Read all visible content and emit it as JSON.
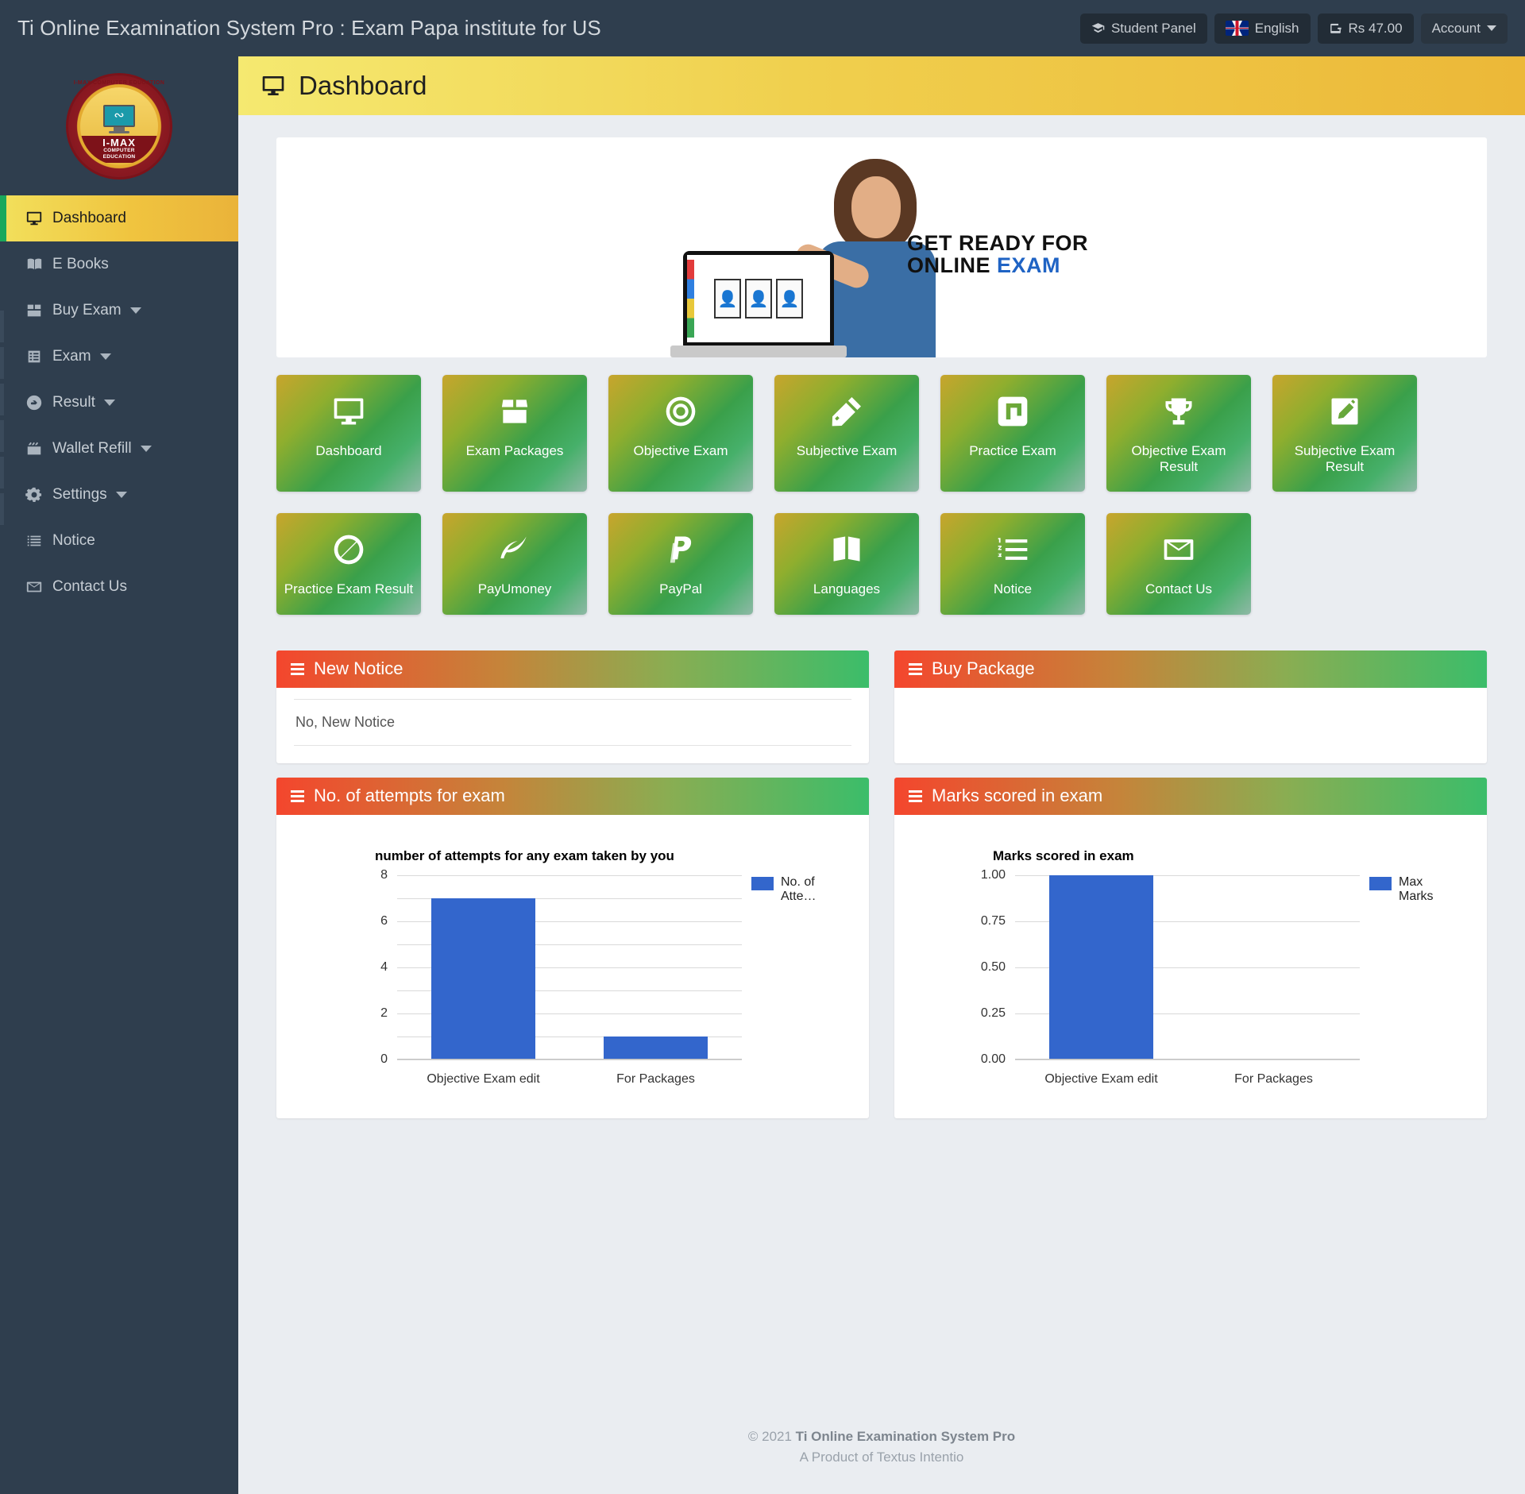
{
  "topbar": {
    "title": "Ti Online Examination System Pro : Exam Papa institute for US",
    "student_panel": "Student Panel",
    "language": "English",
    "wallet": "Rs 47.00",
    "account": "Account"
  },
  "logo": {
    "arc_text": "I-MAX COMPUTER EDUCATION",
    "name": "I-MAX",
    "sub_line1": "COMPUTER",
    "sub_line2": "EDUCATION",
    "ribbon": "I-MAX"
  },
  "sidebar": {
    "items": [
      {
        "label": "Dashboard",
        "icon": "monitor-icon",
        "active": true,
        "has_arrow": false
      },
      {
        "label": "E Books",
        "icon": "book-icon",
        "active": false,
        "has_arrow": false
      },
      {
        "label": "Buy Exam",
        "icon": "box-icon",
        "active": false,
        "has_arrow": true
      },
      {
        "label": "Exam",
        "icon": "list-alt-icon",
        "active": false,
        "has_arrow": true
      },
      {
        "label": "Result",
        "icon": "result-icon",
        "active": false,
        "has_arrow": true
      },
      {
        "label": "Wallet Refill",
        "icon": "wallet-icon",
        "active": false,
        "has_arrow": true
      },
      {
        "label": "Settings",
        "icon": "gears-icon",
        "active": false,
        "has_arrow": true
      },
      {
        "label": "Notice",
        "icon": "notice-icon",
        "active": false,
        "has_arrow": false
      },
      {
        "label": "Contact Us",
        "icon": "envelope-icon",
        "active": false,
        "has_arrow": false
      }
    ]
  },
  "page": {
    "title": "Dashboard",
    "icon": "monitor-icon"
  },
  "banner": {
    "line1": "GET READY FOR",
    "line2_a": "ONLINE ",
    "line2_b": "EXAM"
  },
  "tiles": [
    {
      "label": "Dashboard",
      "icon": "monitor-icon"
    },
    {
      "label": "Exam Packages",
      "icon": "box-open-icon"
    },
    {
      "label": "Objective Exam",
      "icon": "target-icon"
    },
    {
      "label": "Subjective Exam",
      "icon": "pencil-ruler-icon"
    },
    {
      "label": "Practice Exam",
      "icon": "corner-square-icon"
    },
    {
      "label": "Objective Exam Result",
      "icon": "trophy-icon"
    },
    {
      "label": "Subjective Exam Result",
      "icon": "pencil-square-icon"
    },
    {
      "label": "Practice Exam Result",
      "icon": "circle-slash-icon"
    },
    {
      "label": "PayUmoney",
      "icon": "payumoney-icon"
    },
    {
      "label": "PayPal",
      "icon": "paypal-icon"
    },
    {
      "label": "Languages",
      "icon": "language-icon"
    },
    {
      "label": "Notice",
      "icon": "numbered-list-icon"
    },
    {
      "label": "Contact Us",
      "icon": "envelope-icon"
    }
  ],
  "panels": {
    "new_notice": {
      "title": "New Notice",
      "body": "No, New Notice"
    },
    "buy_package": {
      "title": "Buy Package",
      "body": ""
    },
    "attempts": {
      "title": "No. of attempts for exam"
    },
    "marks": {
      "title": "Marks scored in exam"
    }
  },
  "footer": {
    "copyright_prefix": "© 2021 ",
    "copyright_name": "Ti Online Examination System Pro",
    "product": "A Product of Textus Intentio"
  },
  "colors": {
    "sidebar_bg": "#2f3e4e",
    "accent_yellow": "#f0cf4d",
    "tile_green": "#3aa04a",
    "panel_red": "#f4462d",
    "panel_green": "#3bbd6a",
    "bar_blue": "#3366cc"
  },
  "chart_data": [
    {
      "type": "bar",
      "title": "number of attempts for any exam taken by you",
      "categories": [
        "Objective Exam edit",
        "For Packages"
      ],
      "series": [
        {
          "name": "No. of Atte…",
          "values": [
            7,
            1
          ]
        }
      ],
      "legend_label": "No. of Atte…",
      "yticks": [
        "0",
        "2",
        "4",
        "6",
        "8"
      ],
      "ylim": [
        0,
        8
      ],
      "grid_step": 1,
      "grid": true,
      "legend_position": "right",
      "xlabel": "",
      "ylabel": ""
    },
    {
      "type": "bar",
      "title": "Marks scored in exam",
      "categories": [
        "Objective Exam edit",
        "For Packages"
      ],
      "series": [
        {
          "name": "Max Marks",
          "values": [
            1.0,
            0
          ]
        }
      ],
      "legend_label": "Max Marks",
      "yticks": [
        "0.00",
        "0.25",
        "0.50",
        "0.75",
        "1.00"
      ],
      "ylim": [
        0,
        1
      ],
      "grid_step": 0.25,
      "grid": true,
      "legend_position": "right",
      "xlabel": "",
      "ylabel": ""
    }
  ]
}
